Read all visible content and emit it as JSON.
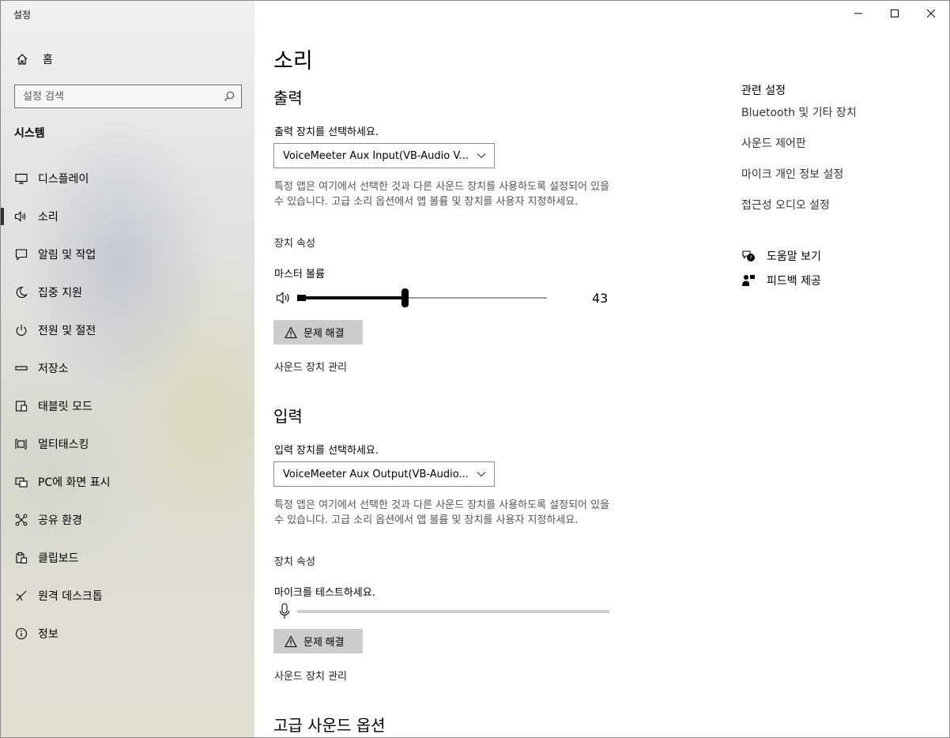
{
  "window": {
    "title": "설정"
  },
  "sidebar": {
    "home_label": "홈",
    "search_placeholder": "설정 검색",
    "section_label": "시스템",
    "items": [
      {
        "label": "디스플레이",
        "icon": "monitor-icon"
      },
      {
        "label": "소리",
        "icon": "speaker-icon",
        "active": true
      },
      {
        "label": "알림 및 작업",
        "icon": "notification-icon"
      },
      {
        "label": "집중 지원",
        "icon": "moon-icon"
      },
      {
        "label": "전원 및 절전",
        "icon": "power-icon"
      },
      {
        "label": "저장소",
        "icon": "storage-icon"
      },
      {
        "label": "태블릿 모드",
        "icon": "tablet-icon"
      },
      {
        "label": "멀티태스킹",
        "icon": "multitask-icon"
      },
      {
        "label": "PC에 화면 표시",
        "icon": "project-icon"
      },
      {
        "label": "공유 환경",
        "icon": "share-icon"
      },
      {
        "label": "클립보드",
        "icon": "clipboard-icon"
      },
      {
        "label": "원격 데스크톱",
        "icon": "remote-desktop-icon"
      },
      {
        "label": "정보",
        "icon": "info-icon"
      }
    ]
  },
  "main": {
    "title": "소리",
    "output": {
      "heading": "출력",
      "select_label": "출력 장치를 선택하세요.",
      "device": "VoiceMeeter Aux Input(VB-Audio V...",
      "description": "특정 앱은 여기에서 선택한 것과 다른 사운드 장치를 사용하도록 설정되어 있을 수 있습니다. 고급 소리 옵션에서 앱 볼륨 및 장치를 사용자 지정하세요.",
      "properties_link": "장치 속성",
      "volume_label": "마스터 볼륨",
      "volume_value": "43",
      "volume_fraction": 0.43,
      "troubleshoot_label": "문제 해결",
      "manage_link": "사운드 장치 관리"
    },
    "input": {
      "heading": "입력",
      "select_label": "입력 장치를 선택하세요.",
      "device": "VoiceMeeter Aux Output(VB-Audio...",
      "description": "특정 앱은 여기에서 선택한 것과 다른 사운드 장치를 사용하도록 설정되어 있을 수 있습니다. 고급 소리 옵션에서 앱 볼륨 및 장치를 사용자 지정하세요.",
      "properties_link": "장치 속성",
      "mic_test_label": "마이크를 테스트하세요.",
      "troubleshoot_label": "문제 해결",
      "manage_link": "사운드 장치 관리"
    },
    "advanced_heading": "고급 사운드 옵션"
  },
  "related": {
    "title": "관련 설정",
    "links": [
      "Bluetooth 및 기타 장치",
      "사운드 제어판",
      "마이크 개인 정보 설정",
      "접근성 오디오 설정"
    ],
    "help_label": "도움말 보기",
    "feedback_label": "피드백 제공"
  }
}
